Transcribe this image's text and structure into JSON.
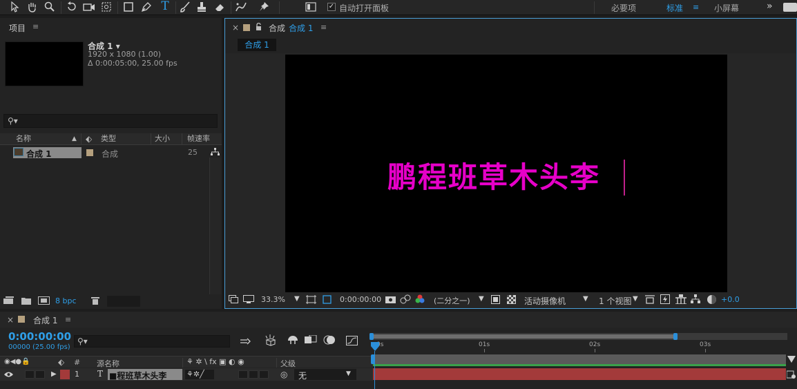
{
  "toolbar": {
    "icons": [
      "selection-tool-icon",
      "hand-tool-icon",
      "zoom-tool-icon",
      "rotate-tool-icon",
      "camera-tool-icon",
      "pan-behind-tool-icon",
      "rectangle-tool-icon",
      "pen-tool-icon",
      "type-tool-icon",
      "brush-tool-icon",
      "clone-stamp-tool-icon",
      "eraser-tool-icon",
      "roto-brush-tool-icon",
      "puppet-pin-tool-icon",
      "panel-toggle-icon"
    ],
    "auto_open_label": "自动打开面板",
    "auto_open_checked": true,
    "workspaces": [
      "必要项",
      "标准",
      "小屏幕"
    ],
    "active_workspace": "标准",
    "overflow": "»"
  },
  "project": {
    "title": "项目",
    "menu": "≡",
    "item_name": "合成 1 ▾",
    "item_res": "1920 x 1080 (1.00)",
    "item_dur": "Δ 0:00:05:00, 25.00 fps",
    "search_glyph": "⚲▾",
    "columns": {
      "name": "名称",
      "type": "类型",
      "size": "大小",
      "fps": "帧速率"
    },
    "rows": [
      {
        "name": "合成 1",
        "type": "合成",
        "size": "",
        "fps": "25"
      }
    ],
    "bpc": "8 bpc"
  },
  "composition": {
    "tab_close": "×",
    "tab_prefix": "合成",
    "tab_name": "合成 1",
    "menu": "≡",
    "breadcrumb": "合成 1",
    "canvas_text": "鹏程班草木头李",
    "text_color": "#e600c8",
    "zoom": "33.3%",
    "timecode": "0:00:00:00",
    "resolution": "(二分之一)",
    "camera": "活动摄像机",
    "views": "1 个视图",
    "exposure": "+0.0"
  },
  "timeline": {
    "close": "×",
    "title": "合成 1",
    "menu": "≡",
    "timecode": "0:00:00:00",
    "frame_info": "00000 (25.00 fps)",
    "search_glyph": "⚲▾",
    "columns": {
      "hash": "#",
      "source": "源名称",
      "parent": "父级"
    },
    "switch_glyphs": "⚘ ✲ \\ fx ▣ ◐ ◉",
    "ruler": [
      "0s",
      "01s",
      "02s",
      "03s"
    ],
    "layer": {
      "index": "1",
      "type_glyph": "T",
      "name": "■程班草木头李",
      "parent": "无"
    },
    "accent": "#2b8fd9",
    "layer_bar_color": "#a33a3a"
  }
}
